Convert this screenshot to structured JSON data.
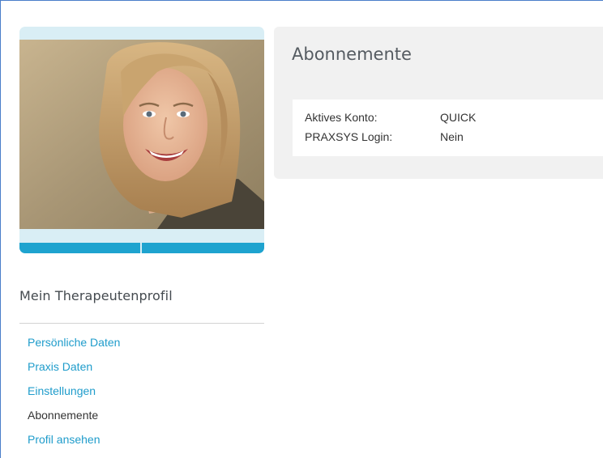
{
  "sidebar": {
    "heading": "Mein Therapeutenprofil",
    "photo_actions": {
      "edit_icon": "edit-icon",
      "delete_icon": "trash-icon"
    },
    "items": [
      {
        "label": "Persönliche Daten",
        "active": false
      },
      {
        "label": "Praxis Daten",
        "active": false
      },
      {
        "label": "Einstellungen",
        "active": false
      },
      {
        "label": "Abonnemente",
        "active": true
      },
      {
        "label": "Profil ansehen",
        "active": false
      }
    ]
  },
  "main": {
    "title": "Abonnemente",
    "rows": [
      {
        "label": "Aktives Konto:",
        "value": "QUICK"
      },
      {
        "label": "PRAXSYS Login:",
        "value": "Nein"
      }
    ]
  },
  "colors": {
    "accent": "#1ea3cf",
    "link": "#1f9ccb",
    "panel": "#f1f1f1",
    "card": "#d9eef5"
  }
}
